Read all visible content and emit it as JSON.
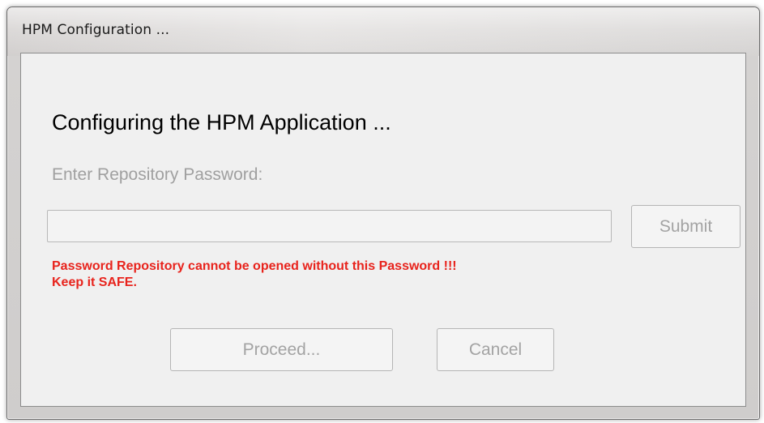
{
  "window": {
    "title": "HPM Configuration ..."
  },
  "dialog": {
    "heading": "Configuring the HPM Application ...",
    "password_label": "Enter Repository Password:",
    "password_value": "",
    "submit_label": "Submit",
    "warning_line1": "Password Repository cannot be opened without this Password !!!",
    "warning_line2": "Keep it SAFE.",
    "proceed_label": "Proceed...",
    "cancel_label": "Cancel"
  },
  "colors": {
    "warning_text": "#e8231c",
    "disabled_text": "#a3a3a3",
    "client_background": "#f0f0f0"
  }
}
